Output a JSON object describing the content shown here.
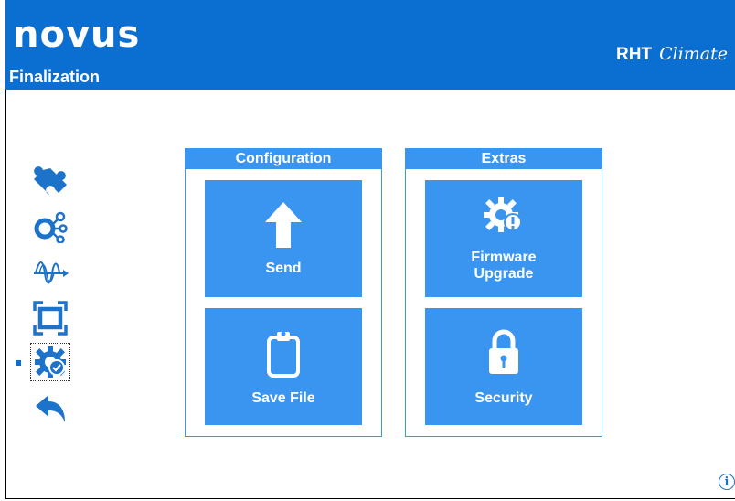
{
  "header": {
    "logo_text": "novus",
    "page_title": "Finalization",
    "product_name": "RHT",
    "product_script": "Climate"
  },
  "sidebar": {
    "items": [
      {
        "icon": "puzzle-icon"
      },
      {
        "icon": "network-icon"
      },
      {
        "icon": "signal-wave-icon"
      },
      {
        "icon": "frame-icon"
      },
      {
        "icon": "gear-check-icon",
        "selected": true
      },
      {
        "icon": "back-arrow-icon"
      }
    ]
  },
  "panels": {
    "configuration": {
      "title": "Configuration",
      "send_label": "Send",
      "save_label": "Save File"
    },
    "extras": {
      "title": "Extras",
      "firmware_label_1": "Firmware",
      "firmware_label_2": "Upgrade",
      "security_label": "Security"
    }
  },
  "info_glyph": "i",
  "colors": {
    "header_blue": "#0b6fd2",
    "tile_blue": "#3a95f0",
    "icon_blue": "#1d72c9"
  }
}
